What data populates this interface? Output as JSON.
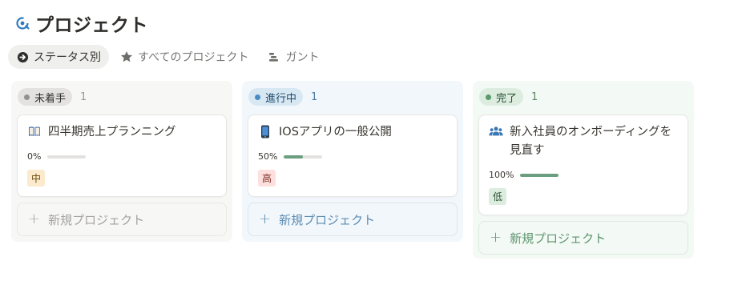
{
  "page": {
    "title": "プロジェクト",
    "icon": "refresh-cycle-icon"
  },
  "tabs": [
    {
      "label": "ステータス別",
      "icon": "arrow-circle-icon",
      "active": true
    },
    {
      "label": "すべてのプロジェクト",
      "icon": "star-icon",
      "active": false
    },
    {
      "label": "ガント",
      "icon": "gantt-icon",
      "active": false
    }
  ],
  "columns": [
    {
      "status": "未着手",
      "count": "1",
      "color": "#91918e",
      "cards": [
        {
          "title": "四半期売上プランニング",
          "icon": "book-icon",
          "progress_label": "0%",
          "progress": 0,
          "priority": "中"
        }
      ],
      "new_label": "新規プロジェクト"
    },
    {
      "status": "進行中",
      "count": "1",
      "color": "#4a8bc4",
      "cards": [
        {
          "title": "IOSアプリの一般公開",
          "icon": "phone-icon",
          "progress_label": "50%",
          "progress": 0.5,
          "priority": "高"
        }
      ],
      "new_label": "新規プロジェクト"
    },
    {
      "status": "完了",
      "count": "1",
      "color": "#5a9a6c",
      "cards": [
        {
          "title": "新入社員のオンボーディングを見直す",
          "icon": "people-icon",
          "progress_label": "100%",
          "progress": 1,
          "priority": "低"
        }
      ],
      "new_label": "新規プロジェクト"
    }
  ]
}
